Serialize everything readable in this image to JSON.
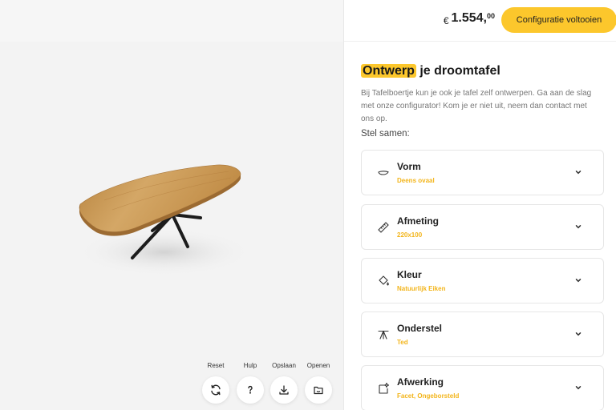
{
  "viewer": {
    "tools": [
      {
        "label": "Reset",
        "icon": "refresh-icon"
      },
      {
        "label": "Hulp",
        "icon": "question-icon"
      },
      {
        "label": "Opslaan",
        "icon": "download-icon"
      },
      {
        "label": "Openen",
        "icon": "open-folder-icon"
      }
    ]
  },
  "header": {
    "price_currency": "€",
    "price_main": "1.554,",
    "price_decimals": "00",
    "cta_label": "Configuratie voltooien"
  },
  "intro": {
    "heading_highlight": "Ontwerp",
    "heading_rest": " je droomtafel",
    "text": "Bij Tafelboertje kun je ook je tafel zelf ontwerpen. Ga aan de slag met onze configurator! Kom je er niet uit, neem dan contact met ons op.",
    "subheading": "Stel samen:"
  },
  "options": [
    {
      "title": "Vorm",
      "value": "Deens ovaal",
      "icon": "shape-icon"
    },
    {
      "title": "Afmeting",
      "value": "220x100",
      "icon": "ruler-icon"
    },
    {
      "title": "Kleur",
      "value": "Natuurlijk Eiken",
      "icon": "paint-bucket-icon"
    },
    {
      "title": "Onderstel",
      "value": "Ted",
      "icon": "table-base-icon"
    },
    {
      "title": "Afwerking",
      "value": "Facet, Ongeborsteld",
      "icon": "finish-sparkle-icon"
    }
  ],
  "colors": {
    "accent": "#fcc72c",
    "accent_text": "#f3b51b",
    "wood": "#c99a55",
    "legs": "#1c1c1c"
  }
}
